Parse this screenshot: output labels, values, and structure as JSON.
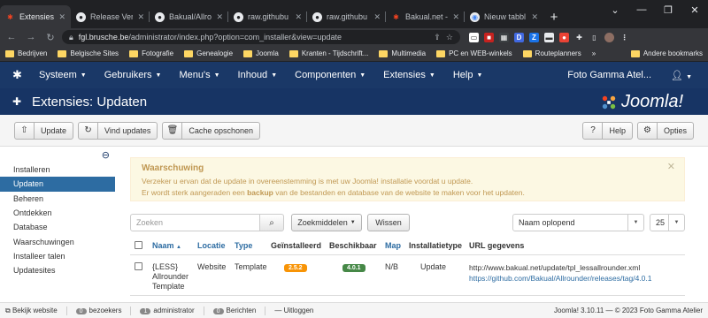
{
  "browser": {
    "tabs": [
      {
        "label": "Extensies: Up",
        "icon": "joomla-icon",
        "active": true
      },
      {
        "label": "Release Vers",
        "icon": "github-icon",
        "active": false
      },
      {
        "label": "Bakual/Allro",
        "icon": "github-icon",
        "active": false
      },
      {
        "label": "raw.githubu",
        "icon": "github-icon",
        "active": false
      },
      {
        "label": "raw.githubu",
        "icon": "github-icon",
        "active": false
      },
      {
        "label": "Bakual.net -",
        "icon": "joomla-icon",
        "active": false
      },
      {
        "label": "Nieuw tabbl",
        "icon": "chrome-icon",
        "active": false
      }
    ],
    "url_host": "fgl.brusche.be",
    "url_path": "/administrator/index.php?option=com_installer&view=update",
    "bookmarks": [
      "Bedrijven",
      "Belgische Sites",
      "Fotografie",
      "Genealogie",
      "Joomla",
      "Kranten - Tijdschrift...",
      "Multimedia",
      "PC en WEB-winkels",
      "Routeplanners"
    ],
    "bookmarks_more": "»",
    "other_bookmarks": "Andere bookmarks"
  },
  "admin_menu": {
    "items": [
      "Systeem",
      "Gebruikers",
      "Menu's",
      "Inhoud",
      "Componenten",
      "Extensies",
      "Help"
    ],
    "site_name": "Foto Gamma Atel..."
  },
  "page": {
    "title": "Extensies: Updaten",
    "brand": "Joomla!"
  },
  "toolbar": {
    "update": "Update",
    "find_updates": "Vind updates",
    "clear_cache": "Cache opschonen",
    "help": "Help",
    "options": "Opties"
  },
  "sidebar": {
    "items": [
      {
        "label": "Installeren",
        "active": false
      },
      {
        "label": "Updaten",
        "active": true
      },
      {
        "label": "Beheren",
        "active": false
      },
      {
        "label": "Ontdekken",
        "active": false
      },
      {
        "label": "Database",
        "active": false
      },
      {
        "label": "Waarschuwingen",
        "active": false
      },
      {
        "label": "Installeer talen",
        "active": false
      },
      {
        "label": "Updatesites",
        "active": false
      }
    ]
  },
  "alert": {
    "heading": "Waarschuwing",
    "line1": "Verzeker u ervan dat de update in overeenstemming is met uw Joomla! installatie voordat u update.",
    "line2_pre": "Er wordt sterk aangeraden een ",
    "line2_bold": "backup",
    "line2_post": " van de bestanden en database van de website te maken voor het updaten."
  },
  "filters": {
    "search_placeholder": "Zoeken",
    "search_tools": "Zoekmiddelen",
    "clear": "Wissen",
    "ordering": "Naam oplopend",
    "limit": "25"
  },
  "table": {
    "headers": {
      "name": "Naam",
      "location": "Locatie",
      "type": "Type",
      "installed": "Geïnstalleerd",
      "available": "Beschikbaar",
      "folder": "Map",
      "install_type": "Installatietype",
      "url": "URL gegevens"
    },
    "rows": [
      {
        "name": "{LESS} Allrounder Template",
        "location": "Website",
        "type": "Template",
        "installed": "2.5.2",
        "available": "4.0.1",
        "folder": "N/B",
        "install_type": "Update",
        "url1": "http://www.bakual.net/update/tpl_lessallrounder.xml",
        "url2": "https://github.com/Bakual/Allrounder/releases/tag/4.0.1"
      }
    ]
  },
  "statusbar": {
    "view_site": "Bekijk website",
    "visitors_count": "0",
    "visitors_label": "bezoekers",
    "admins_count": "1",
    "admins_label": "administrator",
    "messages_count": "0",
    "messages_label": "Berichten",
    "logout": "Uitloggen",
    "copyright": "Joomla! 3.10.11 — © 2023 Foto Gamma Atelier"
  },
  "colors": {
    "header_bg": "#1a3867",
    "sidebar_active": "#2d6ca2",
    "badge_installed": "#f89406",
    "badge_available": "#468847",
    "alert_bg": "#fcf8e3"
  }
}
